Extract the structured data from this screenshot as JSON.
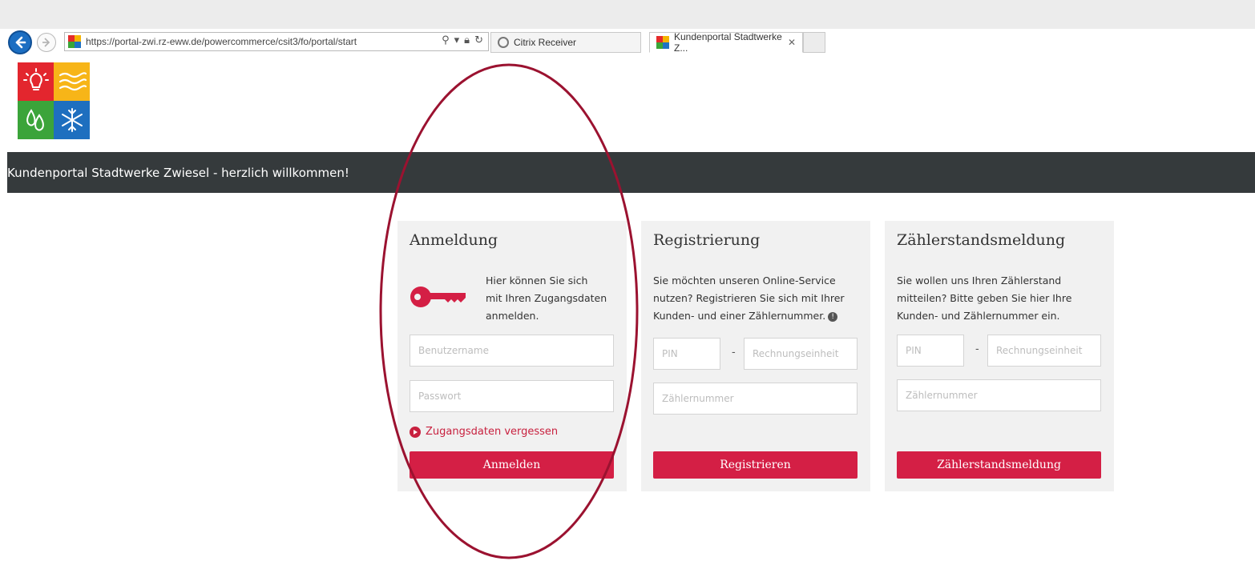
{
  "browser": {
    "url": "https://portal-zwi.rz-eww.de/powercommerce/csit3/fo/portal/start",
    "tabs": [
      {
        "label": "Citrix Receiver"
      },
      {
        "label": "Kundenportal Stadtwerke Z..."
      }
    ]
  },
  "logo": {
    "colors": [
      "#e3262e",
      "#f7b518",
      "#3ba43a",
      "#1e6fbf"
    ],
    "icons": [
      "lightbulb-icon",
      "waves-icon",
      "drops-icon",
      "snowflake-icon"
    ]
  },
  "header": {
    "title": "Kundenportal Stadtwerke Zwiesel - herzlich willkommen!"
  },
  "login": {
    "title": "Anmeldung",
    "text_lines": [
      "Hier können Sie sich",
      "mit Ihren Zugangsdaten",
      "anmelden."
    ],
    "username_placeholder": "Benutzername",
    "password_placeholder": "Passwort",
    "forgot_label": "Zugangsdaten vergessen",
    "button_label": "Anmelden"
  },
  "registration": {
    "title": "Registrierung",
    "text_lines": [
      "Sie möchten unseren Online-Service",
      "nutzen? Registrieren Sie sich mit Ihrer",
      "Kunden- und einer Zählernummer."
    ],
    "pin_placeholder": "PIN",
    "dash": "-",
    "unit_placeholder": "Rechnungseinheit",
    "meter_placeholder": "Zählernummer",
    "button_label": "Registrieren"
  },
  "meter_reading": {
    "title": "Zählerstandsmeldung",
    "text_lines": [
      "Sie wollen uns Ihren Zählerstand",
      "mitteilen? Bitte geben Sie hier Ihre",
      "Kunden- und Zählernummer ein."
    ],
    "pin_placeholder": "PIN",
    "dash": "-",
    "unit_placeholder": "Rechnungseinheit",
    "meter_placeholder": "Zählernummer",
    "button_label": "Zählerstandsmeldung"
  },
  "colors": {
    "accent": "#d41f45",
    "header_bg": "#353a3c",
    "card_bg": "#f1f1f1",
    "annotation": "#9b1230"
  }
}
